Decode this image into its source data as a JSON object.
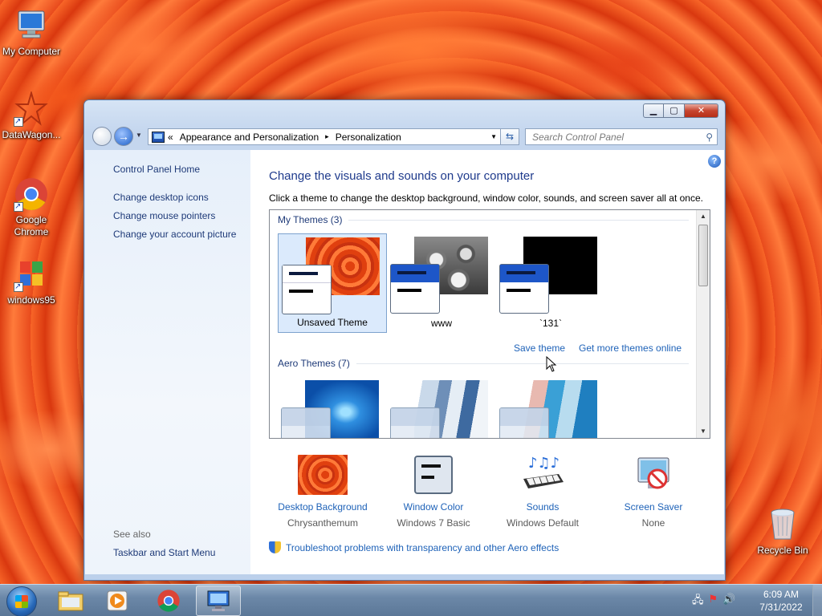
{
  "desktop": {
    "icons": [
      {
        "label": "My Computer"
      },
      {
        "label": "DataWagon..."
      },
      {
        "label": "Google Chrome"
      },
      {
        "label": "windows95"
      },
      {
        "label": "Recycle Bin"
      }
    ]
  },
  "window": {
    "buttons": {
      "min": "▁",
      "max": "▢",
      "close": "✕"
    },
    "address": {
      "prefix": "«",
      "crumbs": [
        "Appearance and Personalization",
        "Personalization"
      ],
      "separator": "▸"
    },
    "search": {
      "placeholder": "Search Control Panel"
    },
    "left_pane": {
      "home": "Control Panel Home",
      "links": [
        "Change desktop icons",
        "Change mouse pointers",
        "Change your account picture"
      ],
      "see_also_label": "See also",
      "see_also_links": [
        "Taskbar and Start Menu"
      ]
    },
    "main": {
      "heading": "Change the visuals and sounds on your computer",
      "description": "Click a theme to change the desktop background, window color, sounds, and screen saver all at once.",
      "groups": [
        {
          "title": "My Themes (3)",
          "themes": [
            {
              "name": "Unsaved Theme",
              "selected": true
            },
            {
              "name": "www",
              "selected": false
            },
            {
              "name": "`131`",
              "selected": false
            }
          ]
        },
        {
          "title": "Aero Themes (7)",
          "themes": []
        }
      ],
      "save_theme": "Save theme",
      "more_themes": "Get more themes online",
      "options": [
        {
          "name": "Desktop Background",
          "value": "Chrysanthemum",
          "icon": "desktop-background-icon"
        },
        {
          "name": "Window Color",
          "value": "Windows 7 Basic",
          "icon": "window-color-icon"
        },
        {
          "name": "Sounds",
          "value": "Windows Default",
          "icon": "sounds-icon"
        },
        {
          "name": "Screen Saver",
          "value": "None",
          "icon": "screen-saver-icon"
        }
      ],
      "troubleshoot": "Troubleshoot problems with transparency and other Aero effects"
    }
  },
  "taskbar": {
    "clock": {
      "time": "6:09 AM",
      "date": "7/31/2022"
    }
  },
  "colors": {
    "link": "#1e62b8",
    "heading": "#1e3a8c",
    "selected_theme_bg": "#dbeafc"
  }
}
